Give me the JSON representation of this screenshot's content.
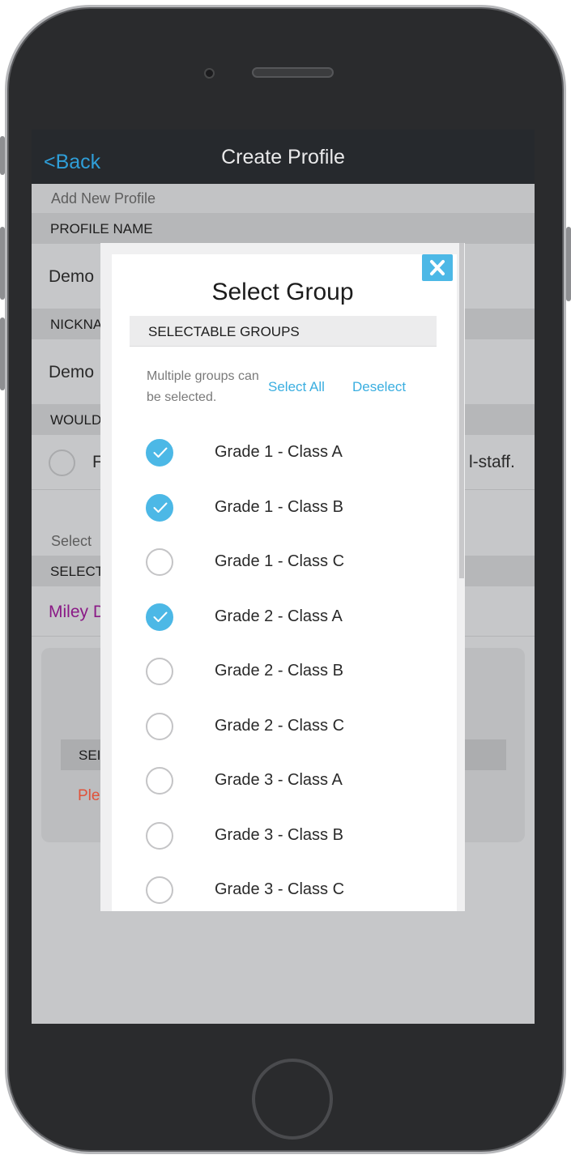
{
  "navbar": {
    "back_label": "<Back",
    "title": "Create Profile"
  },
  "background": {
    "section_title": "Add New Profile",
    "profile_name_label": "PROFILE NAME",
    "profile_name_value": "Demo",
    "nickname_label": "NICKNA",
    "nickname_value": "Demo",
    "would_label": "WOULD",
    "option_prefix": "F",
    "option_suffix": "l-staff.",
    "select_caption": "Select",
    "select_label": "SELECT",
    "selected_person": "Miley D",
    "inner_label": "SEI",
    "warning_text": "Ple"
  },
  "modal": {
    "title": "Select Group",
    "header": "SELECTABLE GROUPS",
    "hint": "Multiple groups can be selected.",
    "select_all": "Select All",
    "deselect": "Deselect",
    "groups": [
      {
        "label": "Grade 1 - Class A",
        "checked": true
      },
      {
        "label": "Grade 1 - Class B",
        "checked": true
      },
      {
        "label": "Grade 1 - Class C",
        "checked": false
      },
      {
        "label": "Grade 2 - Class A",
        "checked": true
      },
      {
        "label": "Grade 2 - Class B",
        "checked": false
      },
      {
        "label": "Grade 2 - Class C",
        "checked": false
      },
      {
        "label": "Grade 3 - Class A",
        "checked": false
      },
      {
        "label": "Grade 3 - Class B",
        "checked": false
      },
      {
        "label": "Grade 3 - Class C",
        "checked": false
      }
    ]
  },
  "colors": {
    "accent": "#4cb8e6",
    "navbar": "#26292d",
    "link": "#3aaee0",
    "person": "#8a1a86",
    "warning": "#e0523a"
  },
  "icons": {
    "close": "close-icon",
    "check": "checkmark-icon"
  }
}
